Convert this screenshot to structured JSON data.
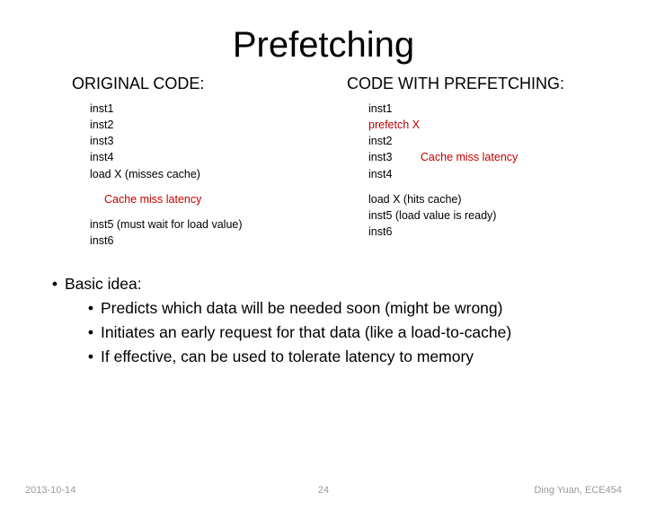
{
  "title": "Prefetching",
  "left": {
    "header": "ORIGINAL CODE:",
    "lines1": [
      "inst1",
      "inst2",
      "inst3",
      "inst4",
      "load X (misses cache)"
    ],
    "latency_label": "Cache miss latency",
    "lines2": [
      "inst5 (must wait for load value)",
      "inst6"
    ]
  },
  "right": {
    "header": "CODE WITH PREFETCHING:",
    "lines1": [
      "inst1"
    ],
    "prefetch": "prefetch X",
    "lines2a": "inst2",
    "lines2b": "inst3",
    "latency_inline": "Cache miss latency",
    "lines2c": "inst4",
    "lines3": [
      "load  X (hits cache)",
      "inst5 (load value is ready)",
      "inst6"
    ]
  },
  "bullets": {
    "b1": "Basic idea:",
    "b2": "Predicts which data will be needed soon (might be wrong)",
    "b3": "Initiates an early request for that data (like a load-to-cache)",
    "b4": "If effective, can be used to tolerate latency to memory"
  },
  "footer": {
    "date": "2013-10-14",
    "page": "24",
    "author": "Ding Yuan, ECE454"
  }
}
